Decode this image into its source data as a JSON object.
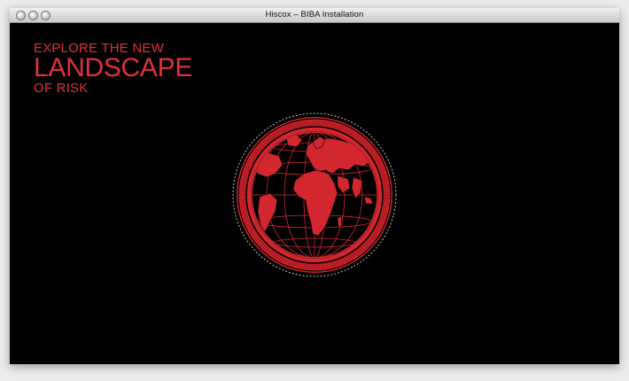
{
  "window": {
    "title": "Hiscox – BIBA Installation"
  },
  "headline": {
    "line1": "EXPLORE THE NEW",
    "line2": "LANDSCAPE",
    "line3": "OF RISK"
  },
  "colors": {
    "accent": "#e0303a",
    "background": "#000000"
  },
  "globe": {
    "icon": "globe-icon"
  }
}
